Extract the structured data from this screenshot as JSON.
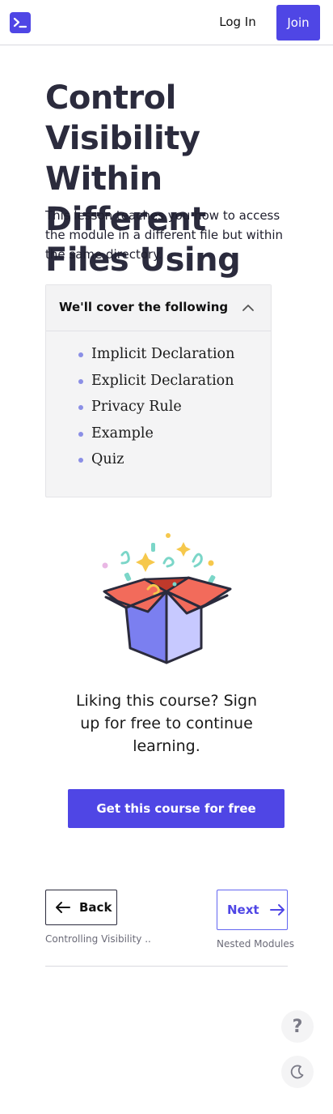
{
  "header": {
    "logo_icon": "terminal-icon",
    "login_label": "Log In",
    "join_label": "Join",
    "accent_color": "#4f46e5"
  },
  "lesson": {
    "title": "Control Visibility Within Different Files Using 'pub'",
    "summary": "This lesson teaches you how to access the module in a different file but within the same directory."
  },
  "cover": {
    "heading": "We'll cover the following",
    "toggle_icon": "chevron-up-icon",
    "items": [
      "Implicit Declaration",
      "Explicit Declaration",
      "Privacy Rule",
      "Example",
      "Quiz"
    ]
  },
  "promo": {
    "illustration": "gift-box-icon",
    "text": "Liking this course? Sign up for free to continue learning.",
    "cta_label": "Get this course for free"
  },
  "navigation": {
    "back_label": "Back",
    "back_subtitle": "Controlling Visibility ...",
    "next_label": "Next",
    "next_subtitle": "Nested Modules"
  },
  "floating": {
    "help_symbol": "?",
    "help_icon": "question-icon",
    "theme_icon": "moon-icon"
  }
}
